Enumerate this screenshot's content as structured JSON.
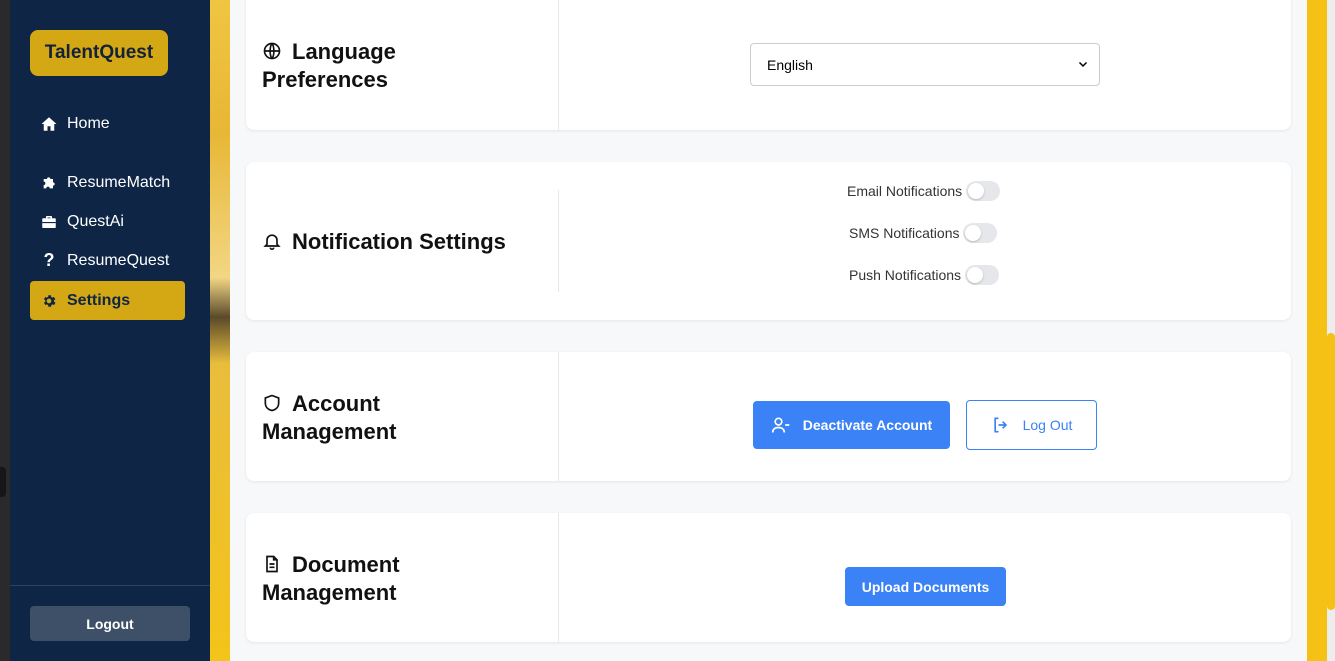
{
  "sidebar": {
    "brand": "TalentQuest",
    "items": [
      {
        "label": "Home",
        "icon": "home-icon"
      },
      {
        "label": "ResumeMatch",
        "icon": "puzzle-icon"
      },
      {
        "label": "QuestAi",
        "icon": "briefcase-icon"
      },
      {
        "label": "ResumeQuest",
        "icon": "question-icon"
      },
      {
        "label": "Settings",
        "icon": "gear-icon",
        "active": true
      }
    ],
    "logout_label": "Logout"
  },
  "sections": {
    "language": {
      "title": "Language Preferences",
      "icon": "globe-icon",
      "selected": "English"
    },
    "notifications": {
      "title": "Notification Settings",
      "icon": "bell-icon",
      "toggles": [
        {
          "label": "Email Notifications",
          "on": false
        },
        {
          "label": "SMS Notifications",
          "on": false
        },
        {
          "label": "Push Notifications",
          "on": false
        }
      ]
    },
    "account": {
      "title": "Account Management",
      "icon": "shield-icon",
      "deactivate_label": "Deactivate Account",
      "logout_label": "Log Out"
    },
    "documents": {
      "title": "Document Management",
      "icon": "document-icon",
      "upload_label": "Upload Documents"
    }
  },
  "colors": {
    "sidebar": "#0f2545",
    "accent": "#d4a814",
    "primary": "#3b82f6"
  }
}
